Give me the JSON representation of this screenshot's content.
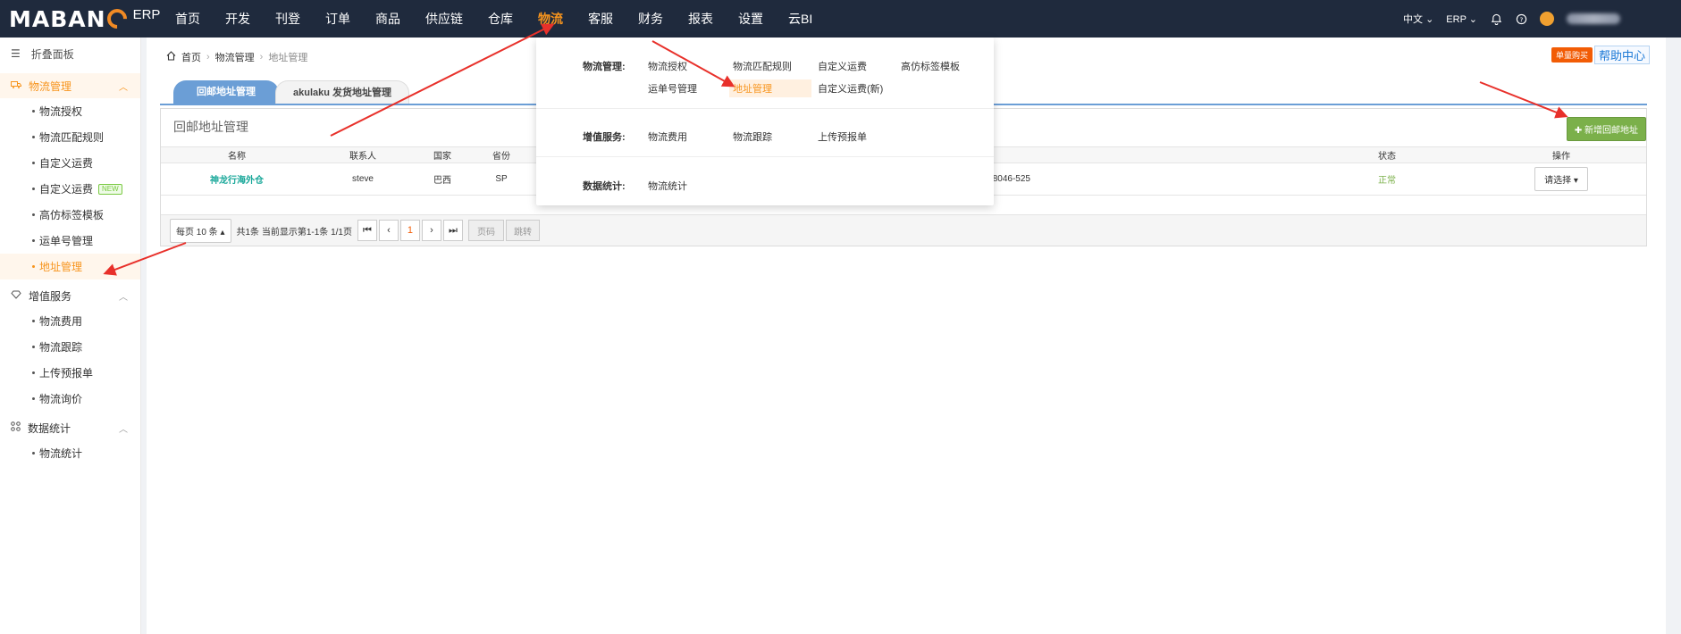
{
  "logo": {
    "main_left": "MABAN",
    "main_right": "",
    "sub": "ERP"
  },
  "nav": [
    {
      "label": "首页",
      "active": false
    },
    {
      "label": "开发",
      "active": false
    },
    {
      "label": "刊登",
      "active": false
    },
    {
      "label": "订单",
      "active": false
    },
    {
      "label": "商品",
      "active": false
    },
    {
      "label": "供应链",
      "active": false
    },
    {
      "label": "仓库",
      "active": false
    },
    {
      "label": "物流",
      "active": true
    },
    {
      "label": "客服",
      "active": false
    },
    {
      "label": "财务",
      "active": false
    },
    {
      "label": "报表",
      "active": false
    },
    {
      "label": "设置",
      "active": false
    },
    {
      "label": "云BI",
      "active": false
    }
  ],
  "topright": {
    "lang": "中文",
    "sys": "ERP"
  },
  "sidebar": {
    "collapse": "折叠面板",
    "groups": [
      {
        "label": "物流管理",
        "items": [
          "物流授权",
          "物流匹配规则",
          "自定义运费",
          "自定义运费",
          "高仿标签模板",
          "运单号管理",
          "地址管理"
        ]
      },
      {
        "label": "增值服务",
        "items": [
          "物流费用",
          "物流跟踪",
          "上传预报单",
          "物流询价"
        ]
      },
      {
        "label": "数据统计",
        "items": [
          "物流统计"
        ]
      }
    ],
    "new_badge": "NEW"
  },
  "breadcrumb": {
    "home": "首页",
    "level1": "物流管理",
    "current": "地址管理"
  },
  "buttons": {
    "buy": "单量购买",
    "help": "帮助中心",
    "add": "新增回邮地址",
    "select": "请选择"
  },
  "tabs": [
    "回邮地址管理",
    "akulaku 发货地址管理"
  ],
  "panel_title": "回邮地址管理",
  "table": {
    "headers": [
      "名称",
      "联系人",
      "国家",
      "省份",
      "地址",
      "状态",
      "操作"
    ],
    "rows": [
      {
        "name": "神龙行海外仓",
        "contact": "steve",
        "country": "巴西",
        "province": "SP",
        "address": "Rua João Wagner Wey 1565 bl 12 ap604 -CEP 18046-525",
        "status": "正常"
      }
    ]
  },
  "pager": {
    "page_size": "每页 10 条",
    "summary": "共1条 当前显示第1-1条 1/1页",
    "current": "1",
    "input_placeholder": "页码",
    "go": "跳转"
  },
  "dropdown": {
    "sections": [
      {
        "label": "物流管理:",
        "items": [
          "物流授权",
          "物流匹配规则",
          "自定义运费",
          "高仿标签模板",
          "运单号管理",
          "地址管理",
          "自定义运费(新)"
        ]
      },
      {
        "label": "增值服务:",
        "items": [
          "物流费用",
          "物流跟踪",
          "上传预报单"
        ]
      },
      {
        "label": "数据统计:",
        "items": [
          "物流统计"
        ]
      }
    ]
  },
  "colors": {
    "accent": "#f7941d",
    "topbar": "#1f2a3d",
    "tab": "#6b9ed6",
    "add_button": "#7bb04a",
    "arrow": "#e8302a"
  }
}
